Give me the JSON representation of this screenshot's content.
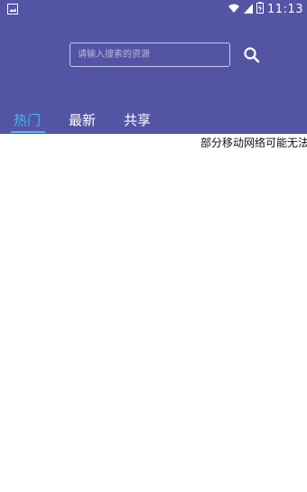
{
  "status_bar": {
    "time": "11:13"
  },
  "search": {
    "placeholder": "请输入搜索的资源",
    "value": ""
  },
  "tabs": [
    {
      "label": "热门",
      "active": true
    },
    {
      "label": "最新",
      "active": false
    },
    {
      "label": "共享",
      "active": false
    }
  ],
  "notice": {
    "text": "部分移动网络可能无法"
  },
  "colors": {
    "header_bg": "#5454a4",
    "accent": "#4fb4f2",
    "text_on_header": "#ffffff"
  },
  "icons": {
    "status_left": "image-icon",
    "status_wifi": "wifi-icon",
    "status_signal": "signal-icon",
    "status_battery": "battery-icon",
    "search": "search-icon"
  }
}
